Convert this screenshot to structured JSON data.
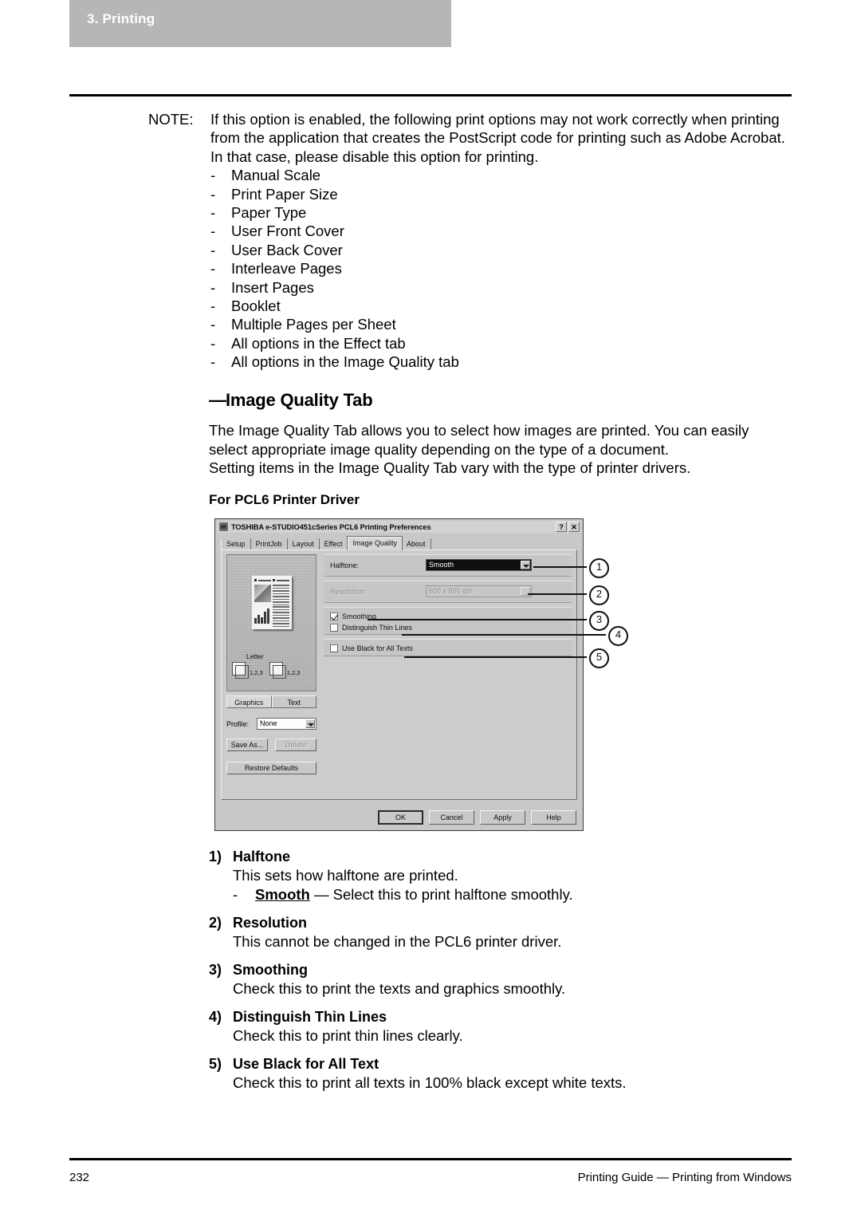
{
  "header": {
    "chapter": "3. Printing"
  },
  "note": {
    "label": "NOTE:",
    "paragraph": "If this option is enabled, the following print options may not work correctly when printing from the application that creates the PostScript code for printing such as Adobe Acrobat.  In that case, please disable this option for printing.",
    "dash": "-",
    "items": [
      "Manual Scale",
      "Print Paper Size",
      "Paper Type",
      "User Front Cover",
      "User Back Cover",
      "Interleave Pages",
      "Insert Pages",
      "Booklet",
      "Multiple Pages per Sheet",
      "All options in the Effect tab",
      "All options in the Image Quality tab"
    ]
  },
  "section": {
    "dash": "—",
    "heading": "Image Quality Tab",
    "intro_line1": "The Image Quality Tab allows you to select how images are printed.  You can easily",
    "intro_line2": "select appropriate image quality depending on the type of a document.",
    "intro_line3": "Setting items in the Image Quality Tab vary with the type of printer drivers.",
    "subheading": "For PCL6 Printer Driver"
  },
  "dialog": {
    "title": "TOSHIBA e-STUDIO451cSeries PCL6 Printing Preferences",
    "help_button": "?",
    "close_button": "✕",
    "tabs": [
      {
        "label": "Setup",
        "active": false
      },
      {
        "label": "PrintJob",
        "active": false
      },
      {
        "label": "Layout",
        "active": false
      },
      {
        "label": "Effect",
        "active": false
      },
      {
        "label": "Image Quality",
        "active": true
      },
      {
        "label": "About",
        "active": false
      }
    ],
    "preview": {
      "paper_label": "Letter",
      "page_order_1": "1,2,3",
      "page_order_2": "1,2,3",
      "graphics_button": "Graphics",
      "text_button": "Text"
    },
    "profile": {
      "label": "Profile:",
      "value": "None",
      "save_as_button": "Save As...",
      "delete_button": "Delete",
      "restore_defaults_button": "Restore Defaults"
    },
    "settings": {
      "halftone_label": "Halftone:",
      "halftone_value": "Smooth",
      "resolution_label": "Resolution:",
      "resolution_value": "600 x 600 dpi",
      "smoothing_label": "Smoothing",
      "smoothing_checked": true,
      "distinguish_label": "Distinguish Thin Lines",
      "distinguish_checked": false,
      "use_black_label": "Use Black for All Texts",
      "use_black_checked": false
    },
    "actions": {
      "ok": "OK",
      "cancel": "Cancel",
      "apply": "Apply",
      "help": "Help"
    }
  },
  "callouts": {
    "one": "1",
    "two": "2",
    "three": "3",
    "four": "4",
    "five": "5"
  },
  "explanations": [
    {
      "num": "1)",
      "title": "Halftone",
      "body": "This sets how halftone are printed.",
      "sub_dash": "-",
      "sub_term": "Smooth",
      "sub_rest": " — Select this to print halftone smoothly."
    },
    {
      "num": "2)",
      "title": "Resolution",
      "body": "This cannot be changed in the PCL6 printer driver."
    },
    {
      "num": "3)",
      "title": "Smoothing",
      "body": "Check this to print the texts and graphics smoothly."
    },
    {
      "num": "4)",
      "title": "Distinguish Thin Lines",
      "body": "Check this to print thin lines clearly."
    },
    {
      "num": "5)",
      "title": "Use Black for All Text",
      "body": "Check this to print all texts in 100% black except white texts."
    }
  ],
  "footer": {
    "page_number": "232",
    "guide": "Printing Guide — Printing from Windows"
  }
}
